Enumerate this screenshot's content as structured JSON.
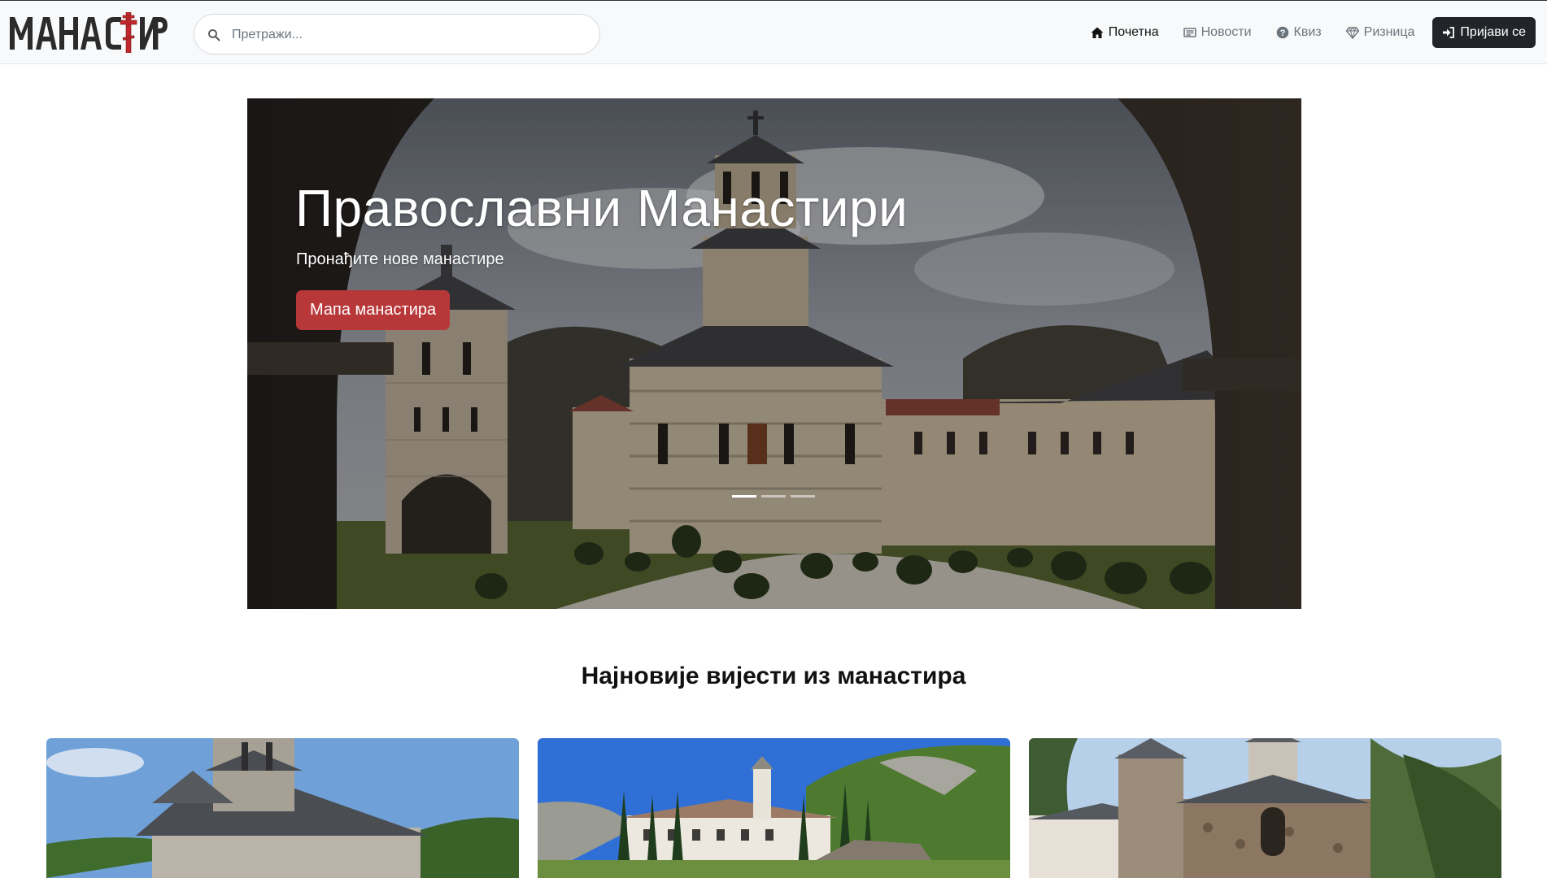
{
  "brand": {
    "logo_text": "МАНАСТИРИ"
  },
  "search": {
    "placeholder": "Претражи..."
  },
  "nav": {
    "home": "Почетна",
    "news": "Новости",
    "quiz": "Квиз",
    "treasury": "Ризница",
    "login": "Пријави се"
  },
  "hero": {
    "title": "Православни Манастири",
    "subtitle": "Пронађите нове манастире",
    "button": "Мапа манастира",
    "slides": 3,
    "active_slide": 1
  },
  "news_section": {
    "title": "Најновије вијести из манастира"
  },
  "colors": {
    "accent": "#b8383a",
    "dark": "#212529",
    "navbar_bg": "#f8f9fa"
  }
}
